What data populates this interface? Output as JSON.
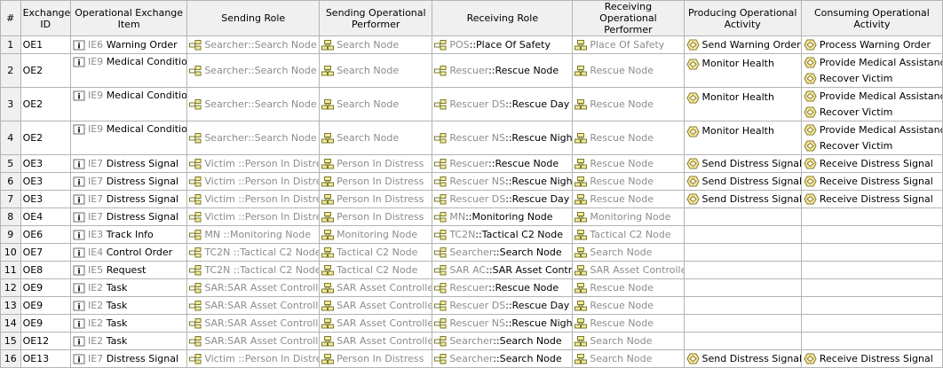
{
  "columns": [
    "#",
    "Exchange ID",
    "Operational Exchange Item",
    "Sending Role",
    "Sending Operational Performer",
    "Receiving Role",
    "Receiving Operational Performer",
    "Producing Operational Activity",
    "Consuming Operational Activity"
  ],
  "rows": [
    {
      "num": "1",
      "id": "OE1",
      "item_tag": "IE6",
      "item": "Warning Order",
      "send_prefix": "Searcher",
      "send_role": "Search Node",
      "send_perf": "Search Node",
      "recv_prefix": "POS",
      "recv_role": "Place Of Safety",
      "recv_perf": "Place Of Safety",
      "produce": [
        "Send Warning Order"
      ],
      "consume": [
        "Process Warning Order"
      ]
    },
    {
      "num": "2",
      "id": "OE2",
      "item_tag": "IE9",
      "item": "Medical Condition",
      "send_prefix": "Searcher",
      "send_role": "Search Node",
      "send_perf": "Search Node",
      "recv_prefix": "Rescuer",
      "recv_role": "Rescue Node",
      "recv_perf": "Rescue Node",
      "produce": [
        "Monitor Health"
      ],
      "consume": [
        "Provide Medical Assistance",
        "Recover Victim"
      ]
    },
    {
      "num": "3",
      "id": "OE2",
      "item_tag": "IE9",
      "item": "Medical Condition",
      "send_prefix": "Searcher",
      "send_role": "Search Node",
      "send_perf": "Search Node",
      "recv_prefix": "Rescuer DS",
      "recv_role": "Rescue Day Shift",
      "recv_perf": "Rescue Node",
      "produce": [
        "Monitor Health"
      ],
      "consume": [
        "Provide Medical Assistance",
        "Recover Victim"
      ]
    },
    {
      "num": "4",
      "id": "OE2",
      "item_tag": "IE9",
      "item": "Medical Condition",
      "send_prefix": "Searcher",
      "send_role": "Search Node",
      "send_perf": "Search Node",
      "recv_prefix": "Rescuer NS",
      "recv_role": "Rescue Night Shift",
      "recv_perf": "Rescue Node",
      "produce": [
        "Monitor Health"
      ],
      "consume": [
        "Provide Medical Assistance",
        "Recover Victim"
      ]
    },
    {
      "num": "5",
      "id": "OE3",
      "item_tag": "IE7",
      "item": "Distress Signal",
      "send_prefix": "Victim ",
      "send_role": "Person In Distress",
      "send_perf": "Person In Distress",
      "recv_prefix": "Rescuer",
      "recv_role": "Rescue Node",
      "recv_perf": "Rescue Node",
      "produce": [
        "Send Distress Signal"
      ],
      "consume": [
        "Receive Distress Signal"
      ]
    },
    {
      "num": "6",
      "id": "OE3",
      "item_tag": "IE7",
      "item": "Distress Signal",
      "send_prefix": "Victim ",
      "send_role": "Person In Distress",
      "send_perf": "Person In Distress",
      "recv_prefix": "Rescuer NS",
      "recv_role": "Rescue Night Shift",
      "recv_perf": "Rescue Node",
      "produce": [
        "Send Distress Signal"
      ],
      "consume": [
        "Receive Distress Signal"
      ]
    },
    {
      "num": "7",
      "id": "OE3",
      "item_tag": "IE7",
      "item": "Distress Signal",
      "send_prefix": "Victim ",
      "send_role": "Person In Distress",
      "send_perf": "Person In Distress",
      "recv_prefix": "Rescuer DS",
      "recv_role": "Rescue Day Shift",
      "recv_perf": "Rescue Node",
      "produce": [
        "Send Distress Signal"
      ],
      "consume": [
        "Receive Distress Signal"
      ]
    },
    {
      "num": "8",
      "id": "OE4",
      "item_tag": "IE7",
      "item": "Distress Signal",
      "send_prefix": "Victim ",
      "send_role": "Person In Distress",
      "send_perf": "Person In Distress",
      "recv_prefix": "MN",
      "recv_role": "Monitoring Node",
      "recv_perf": "Monitoring Node",
      "produce": [],
      "consume": []
    },
    {
      "num": "9",
      "id": "OE6",
      "item_tag": "IE3",
      "item": "Track Info",
      "send_prefix": "MN ",
      "send_role": "Monitoring Node",
      "send_perf": "Monitoring Node",
      "recv_prefix": "TC2N",
      "recv_role": "Tactical C2 Node",
      "recv_perf": "Tactical C2 Node",
      "produce": [],
      "consume": []
    },
    {
      "num": "10",
      "id": "OE7",
      "item_tag": "IE4",
      "item": "Control Order",
      "send_prefix": "TC2N ",
      "send_role": "Tactical C2 Node",
      "send_perf": "Tactical C2 Node",
      "recv_prefix": "Searcher",
      "recv_role": "Search Node",
      "recv_perf": "Search Node",
      "produce": [],
      "consume": []
    },
    {
      "num": "11",
      "id": "OE8",
      "item_tag": "IE5",
      "item": "Request",
      "send_prefix": "TC2N ",
      "send_role": "Tactical C2 Node",
      "send_perf": "Tactical C2 Node",
      "recv_prefix": "SAR AC",
      "recv_role": "SAR Asset Controller",
      "recv_perf": "SAR Asset Controller",
      "produce": [],
      "consume": []
    },
    {
      "num": "12",
      "id": "OE9",
      "item_tag": "IE2",
      "item": "Task",
      "send_prefix": "SAR",
      "send_role": "SAR Asset Controller",
      "send_perf": "SAR Asset Controller",
      "recv_prefix": "Rescuer",
      "recv_role": "Rescue Node",
      "recv_perf": "Rescue Node",
      "produce": [],
      "consume": []
    },
    {
      "num": "13",
      "id": "OE9",
      "item_tag": "IE2",
      "item": "Task",
      "send_prefix": "SAR",
      "send_role": "SAR Asset Controller",
      "send_perf": "SAR Asset Controller",
      "recv_prefix": "Rescuer DS",
      "recv_role": "Rescue Day Shift",
      "recv_perf": "Rescue Node",
      "produce": [],
      "consume": []
    },
    {
      "num": "14",
      "id": "OE9",
      "item_tag": "IE2",
      "item": "Task",
      "send_prefix": "SAR",
      "send_role": "SAR Asset Controller",
      "send_perf": "SAR Asset Controller",
      "recv_prefix": "Rescuer NS",
      "recv_role": "Rescue Night Shift",
      "recv_perf": "Rescue Node",
      "produce": [],
      "consume": []
    },
    {
      "num": "15",
      "id": "OE12",
      "item_tag": "IE2",
      "item": "Task",
      "send_prefix": "SAR",
      "send_role": "SAR Asset Controller",
      "send_perf": "SAR Asset Controller",
      "recv_prefix": "Searcher",
      "recv_role": "Search Node",
      "recv_perf": "Search Node",
      "produce": [],
      "consume": []
    },
    {
      "num": "16",
      "id": "OE13",
      "item_tag": "IE7",
      "item": "Distress Signal",
      "send_prefix": "Victim ",
      "send_role": "Person In Distress",
      "send_perf": "Person In Distress",
      "recv_prefix": "Searcher",
      "recv_role": "Search Node",
      "recv_perf": "Search Node",
      "produce": [
        "Send Distress Signal"
      ],
      "consume": [
        "Receive Distress Signal"
      ]
    }
  ],
  "colors": {
    "header_bg": "#f0f0f0",
    "grid": "#b4b4b4",
    "muted_text": "#8c8c8c",
    "activity_fill": "#f3e9a0",
    "activity_stroke": "#8a7a2a"
  },
  "icons": {
    "item": "info-item-icon",
    "role": "role-icon",
    "performer": "performer-icon",
    "activity": "activity-icon"
  }
}
